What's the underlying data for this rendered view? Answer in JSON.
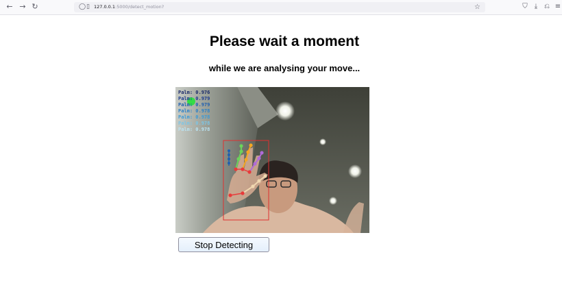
{
  "browser": {
    "back_icon": "arrow-left",
    "forward_icon": "arrow-right",
    "reload_icon": "reload",
    "url_host": "127.0.0.1",
    "url_path": ":5000/detect_motion?",
    "toolbar_icons": [
      "pocket",
      "download",
      "extensions",
      "menu"
    ]
  },
  "page": {
    "title": "Please wait a moment",
    "subtitle": "while we are analysing your move...",
    "stop_button": "Stop Detecting"
  },
  "video_overlay": {
    "labels": [
      {
        "text": "Palm: 0.976",
        "color": "#1a2a6a"
      },
      {
        "text": "Palm: 0.979",
        "color": "#1b3a8f"
      },
      {
        "text": "Palm: 0.979",
        "color": "#1f5fb0"
      },
      {
        "text": "Palm: 0.978",
        "color": "#2a80c8"
      },
      {
        "text": "Palm: 0.978",
        "color": "#3b9ad8"
      },
      {
        "text": "Palm: 0.978",
        "color": "#7cc5e6"
      },
      {
        "text": "Palm: 0.978",
        "color": "#b9e3f2"
      }
    ]
  },
  "colors": {
    "bbox": "#e03030",
    "joint_red": "#e83a3a",
    "finger_green": "#6bd35a",
    "finger_orange": "#f5a623",
    "finger_purple": "#b06ad8",
    "thumb": "#f0d7b0",
    "palm_marker": "#33dd44"
  }
}
